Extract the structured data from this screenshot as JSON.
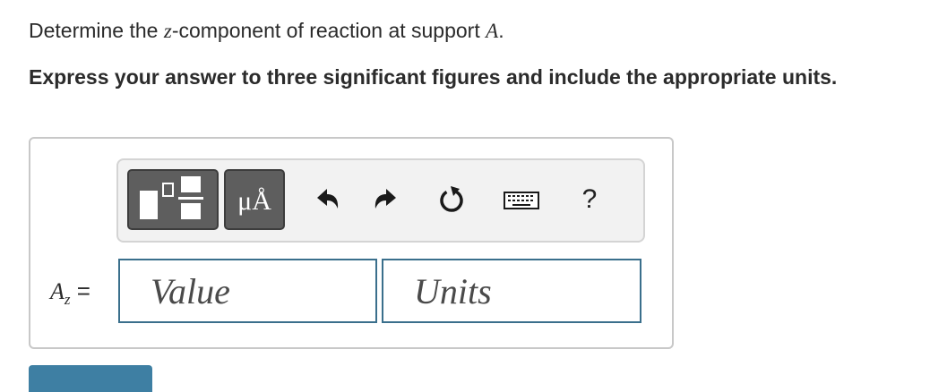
{
  "question": {
    "prefix": "Determine the ",
    "component_var": "z",
    "middle": "-component of reaction at support ",
    "support_var": "A",
    "suffix": "."
  },
  "instruction": "Express your answer to three significant figures and include the appropriate units.",
  "toolbar": {
    "templates_icon": "fraction-template-icon",
    "units_label": "μÅ",
    "undo_icon": "undo-icon",
    "redo_icon": "redo-icon",
    "reset_icon": "reset-icon",
    "keyboard_icon": "keyboard-icon",
    "help_label": "?"
  },
  "answer": {
    "variable": "A",
    "subscript": "z",
    "equals": "=",
    "value_placeholder": "Value",
    "units_placeholder": "Units"
  },
  "colors": {
    "button_dark": "#5e5e5e",
    "input_border": "#3a6f8c",
    "submit_blue": "#3e7fa3"
  }
}
